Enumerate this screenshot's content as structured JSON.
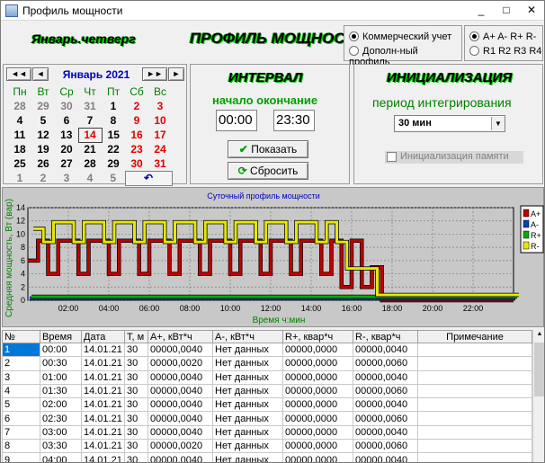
{
  "window": {
    "title": "Профиль мощности",
    "minimize": "_",
    "maximize": "□",
    "close": "✕"
  },
  "header": {
    "date_label": "Январь.четверг",
    "title": "ПРОФИЛЬ МОЩНОСТИ"
  },
  "mode": {
    "options": [
      "Коммерческий учет",
      "Дополн-ный профиль"
    ],
    "selected": 0
  },
  "channels": {
    "row1": "A+ A- R+ R-",
    "row2": "R1 R2 R3 R4"
  },
  "calendar": {
    "nav_prev_year": "◄◄",
    "nav_prev": "◄",
    "nav_next": "►",
    "nav_next_year": "►►",
    "month_label": "Январь 2021",
    "weekdays": [
      "Пн",
      "Вт",
      "Ср",
      "Чт",
      "Пт",
      "Сб",
      "Вс"
    ],
    "weeks": [
      [
        "28",
        "29",
        "30",
        "31",
        "1",
        "2",
        "3"
      ],
      [
        "4",
        "5",
        "6",
        "7",
        "8",
        "9",
        "10"
      ],
      [
        "11",
        "12",
        "13",
        "14",
        "15",
        "16",
        "17"
      ],
      [
        "18",
        "19",
        "20",
        "21",
        "22",
        "23",
        "24"
      ],
      [
        "25",
        "26",
        "27",
        "28",
        "29",
        "30",
        "31"
      ],
      [
        "1",
        "2",
        "3",
        "4",
        "5",
        "6",
        "↶"
      ]
    ]
  },
  "interval": {
    "title": "ИНТЕРВАЛ",
    "start_end_label": "начало окончание",
    "start": "00:00",
    "end": "23:30",
    "show_button": "Показать",
    "reset_button": "Сбросить"
  },
  "init": {
    "title": "ИНИЦИАЛИЗАЦИЯ",
    "period_label": "период интегрирования",
    "period_value": "30 мин",
    "memory_checkbox": "Инициализация памяти"
  },
  "chart_data": {
    "type": "area",
    "title": "Суточный профиль мощности",
    "xlabel": "Время ч:мин",
    "ylabel": "Средняя мощность, Вт (вар)",
    "x_ticks": [
      "02:00",
      "04:00",
      "06:00",
      "08:00",
      "10:00",
      "12:00",
      "14:00",
      "16:00",
      "18:00",
      "20:00",
      "22:00"
    ],
    "y_ticks": [
      "0",
      "2",
      "4",
      "6",
      "8",
      "10",
      "12",
      "14"
    ],
    "ylim": [
      0,
      14
    ],
    "grid": true,
    "legend_position": "right",
    "colors": {
      "A+": "#c00000",
      "A-": "#0040c0",
      "R+": "#00b000",
      "R-": "#e8e800"
    },
    "x": [
      "00:00",
      "00:30",
      "01:00",
      "01:30",
      "02:00",
      "02:30",
      "03:00",
      "03:30",
      "04:00",
      "04:30",
      "05:00",
      "05:30",
      "06:00",
      "06:30",
      "07:00",
      "07:30",
      "08:00",
      "08:30",
      "09:00",
      "09:30",
      "10:00",
      "10:30",
      "11:00",
      "11:30",
      "12:00",
      "12:30",
      "13:00",
      "13:30",
      "14:00",
      "14:30",
      "15:00",
      "15:30",
      "16:00",
      "16:30",
      "17:00",
      "17:30",
      "18:00",
      "18:30",
      "19:00",
      "19:30",
      "20:00",
      "20:30",
      "21:00",
      "21:30",
      "22:00",
      "22:30",
      "23:00",
      "23:30"
    ],
    "series": [
      {
        "name": "A+",
        "values": [
          6,
          9,
          4,
          9,
          9,
          4,
          9,
          9,
          4,
          9,
          9,
          4,
          9,
          9,
          4,
          9,
          9,
          4,
          9,
          9,
          4,
          9,
          9,
          4,
          9,
          9,
          4,
          9,
          9,
          4,
          9,
          2,
          9,
          2,
          5,
          0,
          0,
          0,
          0,
          0,
          0,
          0,
          0,
          0,
          0,
          0,
          0,
          0
        ]
      },
      {
        "name": "A-",
        "values": [
          0,
          0,
          0,
          0,
          0,
          0,
          0,
          0,
          0,
          0,
          0,
          0,
          0,
          0,
          0,
          0,
          0,
          0,
          0,
          0,
          0,
          0,
          0,
          0,
          0,
          0,
          0,
          0,
          0,
          0,
          0,
          0,
          0,
          0,
          0,
          0,
          0,
          0,
          0,
          0,
          0,
          0,
          0,
          0,
          0,
          0,
          0,
          0
        ]
      },
      {
        "name": "R+",
        "values": [
          0,
          0,
          0,
          0,
          0,
          0,
          0,
          0,
          0,
          0,
          0,
          0,
          0,
          0,
          0,
          0,
          0,
          0,
          0,
          0,
          0,
          0,
          0,
          0,
          0,
          0,
          0,
          0,
          0,
          0,
          0,
          0,
          0,
          0,
          0,
          0,
          0,
          0,
          0,
          0,
          0,
          0,
          0,
          0,
          0,
          0,
          0,
          0
        ]
      },
      {
        "name": "R-",
        "values": [
          10,
          8,
          11,
          11,
          8,
          11,
          11,
          8,
          11,
          11,
          8,
          11,
          11,
          8,
          11,
          11,
          8,
          11,
          11,
          8,
          11,
          11,
          8,
          11,
          11,
          8,
          11,
          11,
          8,
          11,
          8,
          4,
          4,
          4,
          0,
          0,
          0,
          0,
          0,
          0,
          0,
          0,
          0,
          0,
          0,
          0,
          0,
          0
        ]
      }
    ]
  },
  "table": {
    "headers": [
      "№",
      "Время",
      "Дата",
      "Т, м",
      "А+, кВт*ч",
      "А-, кВт*ч",
      "R+, квар*ч",
      "R-, квар*ч",
      "Примечание"
    ],
    "rows": [
      [
        "1",
        "00:00",
        "14.01.21",
        "30",
        "00000,0040",
        "Нет данных",
        "00000,0000",
        "00000,0040",
        ""
      ],
      [
        "2",
        "00:30",
        "14.01.21",
        "30",
        "00000,0020",
        "Нет данных",
        "00000,0000",
        "00000,0060",
        ""
      ],
      [
        "3",
        "01:00",
        "14.01.21",
        "30",
        "00000,0040",
        "Нет данных",
        "00000,0000",
        "00000,0040",
        ""
      ],
      [
        "4",
        "01:30",
        "14.01.21",
        "30",
        "00000,0040",
        "Нет данных",
        "00000,0000",
        "00000,0060",
        ""
      ],
      [
        "5",
        "02:00",
        "14.01.21",
        "30",
        "00000,0040",
        "Нет данных",
        "00000,0000",
        "00000,0040",
        ""
      ],
      [
        "6",
        "02:30",
        "14.01.21",
        "30",
        "00000,0040",
        "Нет данных",
        "00000,0000",
        "00000,0060",
        ""
      ],
      [
        "7",
        "03:00",
        "14.01.21",
        "30",
        "00000,0040",
        "Нет данных",
        "00000,0000",
        "00000,0040",
        ""
      ],
      [
        "8",
        "03:30",
        "14.01.21",
        "30",
        "00000,0020",
        "Нет данных",
        "00000,0000",
        "00000,0060",
        ""
      ],
      [
        "9",
        "04:00",
        "14.01.21",
        "30",
        "00000,0040",
        "Нет данных",
        "00000,0000",
        "00000,0040",
        ""
      ]
    ]
  }
}
